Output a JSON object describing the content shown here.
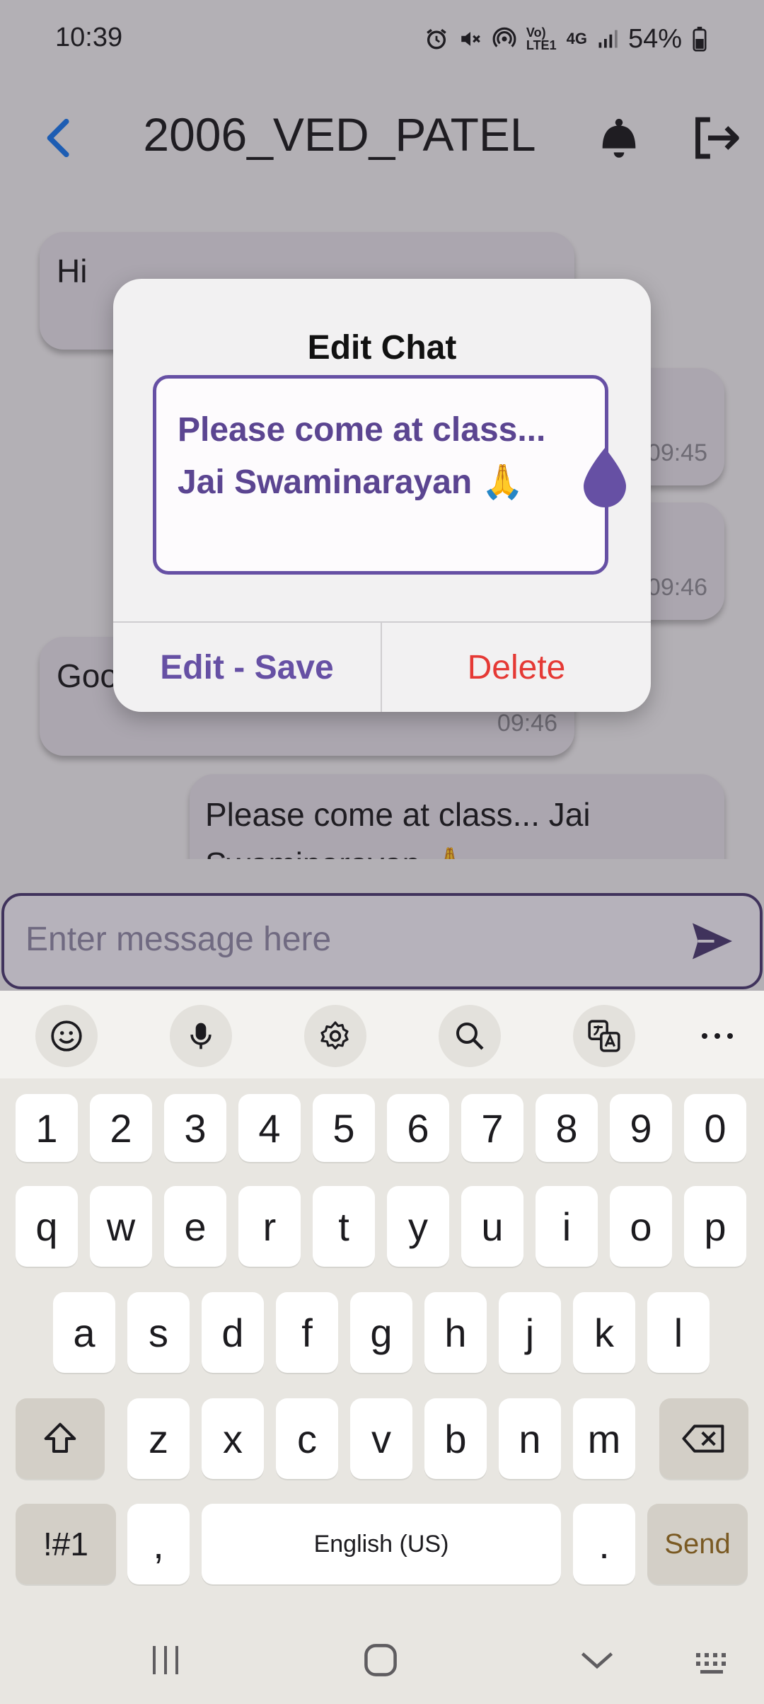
{
  "status_bar": {
    "time": "10:39",
    "battery": "54%",
    "network": "4G"
  },
  "app_bar": {
    "title": "2006_VED_PATEL"
  },
  "messages": [
    {
      "text": "Hi",
      "time": ""
    },
    {
      "text": "",
      "time": "09:45"
    },
    {
      "text": "",
      "time": "09:46"
    },
    {
      "text": "Goo",
      "time": "09:46"
    },
    {
      "text": "Please come at class... Jai",
      "time": "",
      "text2": "Swaminarayan 🙏"
    }
  ],
  "dialog": {
    "title": "Edit Chat",
    "edit_line1": "Please come at class...",
    "edit_line2": "Jai Swaminarayan 🙏",
    "save_label": "Edit - Save",
    "delete_label": "Delete"
  },
  "composer": {
    "placeholder": "Enter message here"
  },
  "keyboard": {
    "number_row": [
      "1",
      "2",
      "3",
      "4",
      "5",
      "6",
      "7",
      "8",
      "9",
      "0"
    ],
    "row1": [
      "q",
      "w",
      "e",
      "r",
      "t",
      "y",
      "u",
      "i",
      "o",
      "p"
    ],
    "row2": [
      "a",
      "s",
      "d",
      "f",
      "g",
      "h",
      "j",
      "k",
      "l"
    ],
    "row3": [
      "z",
      "x",
      "c",
      "v",
      "b",
      "n",
      "m"
    ],
    "symbols_label": "!#1",
    "comma": ",",
    "space_label": "English (US)",
    "period": ".",
    "send_label": "Send"
  },
  "colors": {
    "accent": "#6650a4",
    "delete": "#e53935",
    "bubble": "#ded8e2"
  }
}
